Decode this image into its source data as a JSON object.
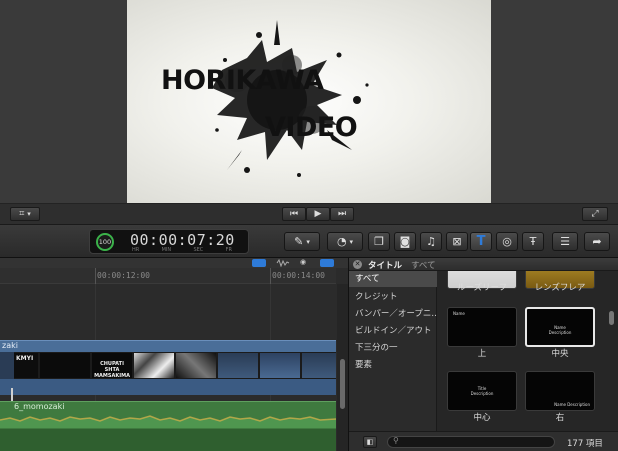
{
  "viewer": {
    "title_line1": "HORIKAWA",
    "title_line2": "VIDEO"
  },
  "toolbar": {
    "timecode": "00:00:07:20",
    "timecode_units": [
      "HR",
      "MIN",
      "SEC",
      "FR"
    ],
    "audio_level": "100"
  },
  "timeline": {
    "ruler_labels": [
      "00:00:12:00",
      "00:00:14:00"
    ],
    "clip_partial_label": "zaki",
    "audio_clip_label": "6_momozaki",
    "thumb_texts": [
      "KMYI",
      "CHUPATI\nSHTA\nMAMSAKIMA"
    ]
  },
  "browser": {
    "header_title": "タイトル",
    "header_subtitle": "すべて",
    "categories": [
      "すべて",
      "クレジット",
      "バンパー／オープニ...",
      "ビルドイン／アウト",
      "下三分の一",
      "要素"
    ],
    "thumbs": [
      {
        "label": "ルーズリーフ"
      },
      {
        "label": "レンズフレア"
      },
      {
        "label": "上",
        "inner": "Name"
      },
      {
        "label": "中央",
        "inner": "Name\nDescription"
      },
      {
        "label": "中心",
        "inner": "Title\nDescription"
      },
      {
        "label": "右",
        "inner": "Name Description"
      }
    ],
    "count": "177 項目",
    "search_placeholder": ""
  },
  "colors": {
    "accent_blue": "#2e7bd9",
    "video_lane": "#3b5b83",
    "audio_lane": "#3f7a3f",
    "timecode_text": "#d8d8d8"
  }
}
